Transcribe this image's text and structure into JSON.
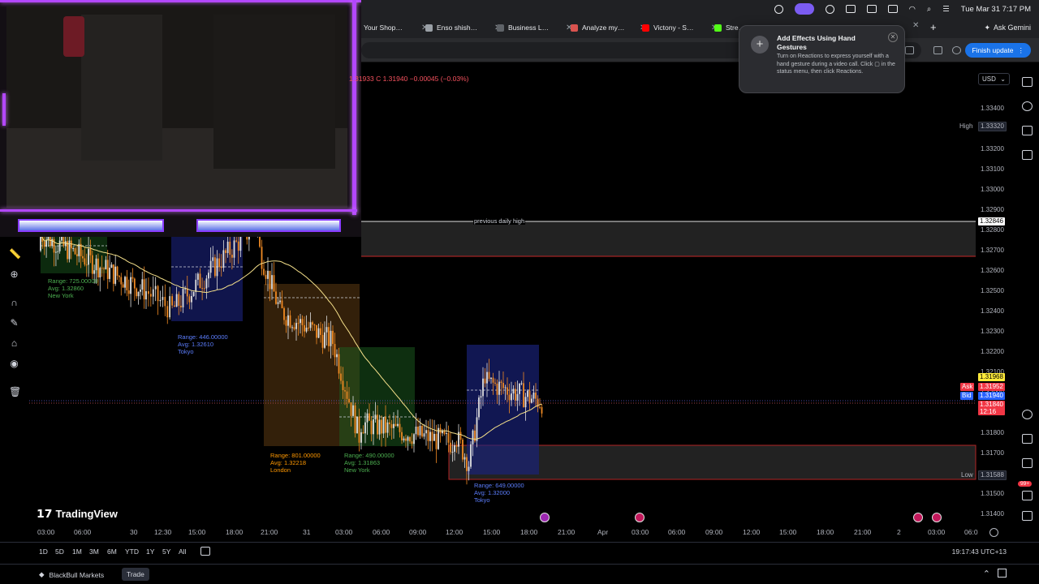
{
  "browser": {
    "tabs": [
      {
        "label": "Your Shop…",
        "favicon": "shop-icon",
        "color": "#5f6368"
      },
      {
        "label": "Enso shish…",
        "favicon": "circle-icon",
        "color": "#9aa0a6"
      },
      {
        "label": "Business L…",
        "favicon": "globe-icon",
        "color": "#5f6368"
      },
      {
        "label": "Analyze my…",
        "favicon": "spark-icon",
        "color": "#d9534f"
      },
      {
        "label": "Victony - S…",
        "favicon": "youtube-icon",
        "color": "#ff0000"
      },
      {
        "label": "Stre…",
        "favicon": "green-k-icon",
        "color": "#53fc18"
      }
    ],
    "ask_gemini": "Ask Gemini",
    "finish_update": "Finish update",
    "clock": "Tue Mar 31  7:17 PM"
  },
  "notification": {
    "title": "Add Effects Using Hand Gestures",
    "body": "Turn on Reactions to express yourself with a hand gesture during a video call. Click ▢ in the status menu, then click Reactions."
  },
  "chart": {
    "ohlc_text": "1.31933  C 1.31940  −0.00045 (−0.03%)",
    "currency": "USD",
    "price_ticks": [
      "1.33400",
      "1.33300",
      "1.33200",
      "1.33100",
      "1.33000",
      "1.32900",
      "1.32800",
      "1.32700",
      "1.32600",
      "1.32500",
      "1.32400",
      "1.32300",
      "1.32200",
      "1.32100",
      "1.32000",
      "1.31900",
      "1.31800",
      "1.31700",
      "1.31600",
      "1.31500",
      "1.31400"
    ],
    "high_label": "High",
    "high_value": "1.33320",
    "prev_high_value": "1.32846",
    "last_price": "1.31968",
    "ask_label": "Ask",
    "ask_value": "1.31952",
    "bid_label": "Bid",
    "bid_value": "1.31940",
    "countdown_price": "1.31840",
    "countdown": "12:16",
    "low_label": "Low",
    "low_value": "1.31588",
    "previous_daily_high": "previous daily high",
    "sessions": [
      {
        "range": "Range: 725.00000",
        "avg": "Avg: 1.32860",
        "name": "New York",
        "color": "#4caf50"
      },
      {
        "range": "Range: 446.00000",
        "avg": "Avg: 1.32610",
        "name": "Tokyo",
        "color": "#5b7cfa"
      },
      {
        "range": "Range: 801.00000",
        "avg": "Avg: 1.32218",
        "name": "London",
        "color": "#ff9800"
      },
      {
        "range": "Range: 490.00000",
        "avg": "Avg: 1.31863",
        "name": "New York",
        "color": "#4caf50"
      },
      {
        "range": "Range: 649.00000",
        "avg": "Avg: 1.32000",
        "name": "Tokyo",
        "color": "#5b7cfa"
      }
    ],
    "time_labels": [
      "03:00",
      "06:00",
      "30",
      "12:30",
      "15:00",
      "18:00",
      "21:00",
      "31",
      "03:00",
      "06:00",
      "09:00",
      "12:00",
      "15:00",
      "18:00",
      "21:00",
      "Apr",
      "03:00",
      "06:00",
      "09:00",
      "12:00",
      "15:00",
      "18:00",
      "21:00",
      "2",
      "03:00",
      "06:0"
    ],
    "logo_text": "TradingView",
    "timezone_clock": "19:17:43 UTC+13",
    "periods": [
      "1D",
      "5D",
      "1M",
      "3M",
      "6M",
      "YTD",
      "1Y",
      "5Y",
      "All"
    ],
    "badge": "99+"
  },
  "broker": {
    "name": "BlackBull Markets",
    "trade": "Trade"
  }
}
